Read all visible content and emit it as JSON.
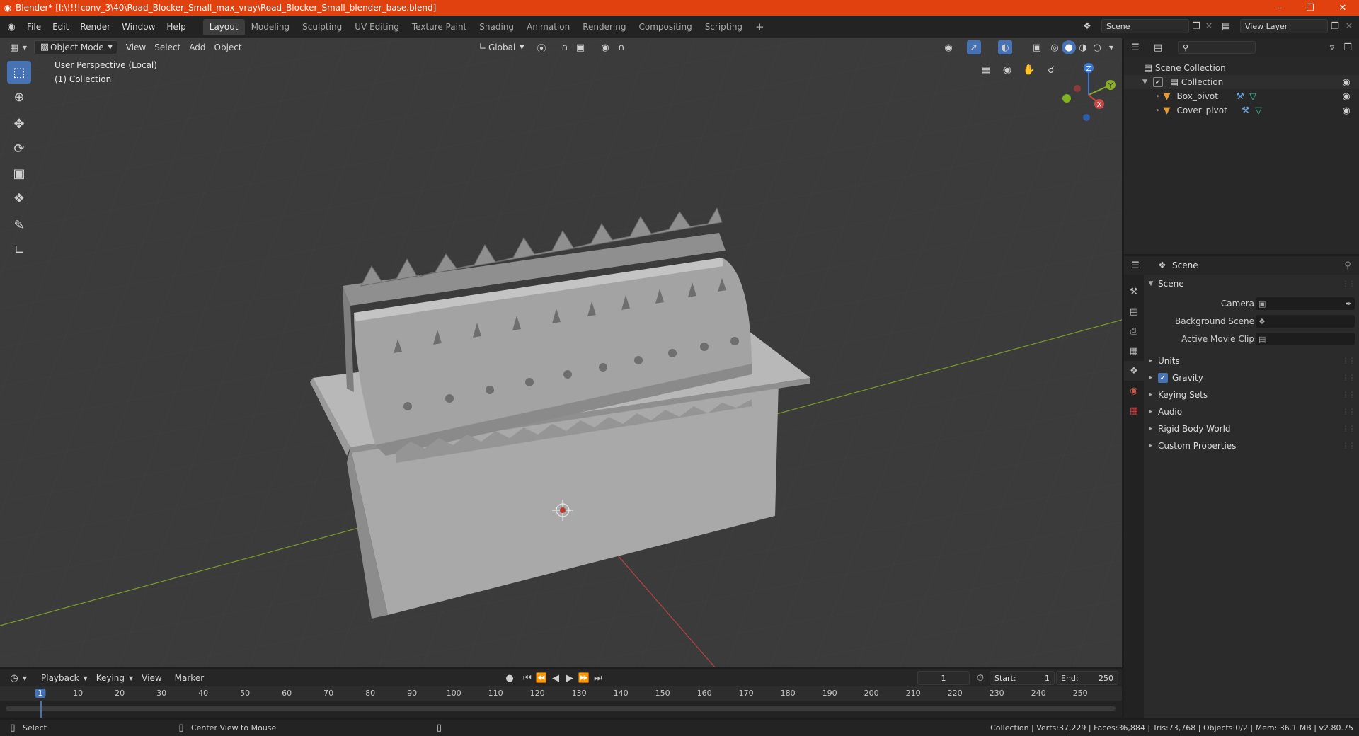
{
  "window": {
    "title": "Blender* [I:\\!!!!conv_3\\40\\Road_Blocker_Small_max_vray\\Road_Blocker_Small_blender_base.blend]",
    "minimize": "–",
    "maximize": "❐",
    "close": "✕"
  },
  "menu": [
    "File",
    "Edit",
    "Render",
    "Window",
    "Help"
  ],
  "workspaces": [
    "Layout",
    "Modeling",
    "Sculpting",
    "UV Editing",
    "Texture Paint",
    "Shading",
    "Animation",
    "Rendering",
    "Compositing",
    "Scripting"
  ],
  "workspace_add": "+",
  "scene_field": "Scene",
  "view_layer_field": "View Layer",
  "viewport_header": {
    "mode": "Object Mode",
    "menus": [
      "View",
      "Select",
      "Add",
      "Object"
    ],
    "orientation": "Global"
  },
  "viewport": {
    "perspective_label": "User Perspective (Local)",
    "collection_label": "(1) Collection",
    "gizmo": {
      "x": "X",
      "y": "Y",
      "z": "Z"
    }
  },
  "outliner": {
    "root": "Scene Collection",
    "collection": "Collection",
    "objects": [
      "Box_pivot",
      "Cover_pivot"
    ]
  },
  "properties": {
    "context": "Scene",
    "section": "Scene",
    "fields": [
      {
        "label": "Camera"
      },
      {
        "label": "Background Scene"
      },
      {
        "label": "Active Movie Clip"
      }
    ],
    "panels": [
      "Units",
      "Gravity",
      "Keying Sets",
      "Audio",
      "Rigid Body World",
      "Custom Properties"
    ]
  },
  "timeline": {
    "menus": [
      "Playback",
      "Keying",
      "View",
      "Marker"
    ],
    "current_frame": "1",
    "start_label": "Start:",
    "start": "1",
    "end_label": "End:",
    "end": "250",
    "ruler": [
      "1",
      "10",
      "20",
      "30",
      "40",
      "50",
      "60",
      "70",
      "80",
      "90",
      "100",
      "110",
      "120",
      "130",
      "140",
      "150",
      "160",
      "170",
      "180",
      "190",
      "200",
      "210",
      "220",
      "230",
      "240",
      "250"
    ]
  },
  "statusbar": {
    "left_action": "Select",
    "middle_action": "Center View to Mouse",
    "stats": "Collection | Verts:37,229 | Faces:36,884 | Tris:73,768 | Objects:0/2 | Mem: 36.1 MB | v2.80.75"
  },
  "colors": {
    "titlebar": "#e0410e",
    "accent": "#4772b3",
    "viewport_bg": "#3b3b3b",
    "x_axis": "#c74a4a",
    "y_axis": "#8aac28",
    "z_axis": "#3c78d8"
  }
}
